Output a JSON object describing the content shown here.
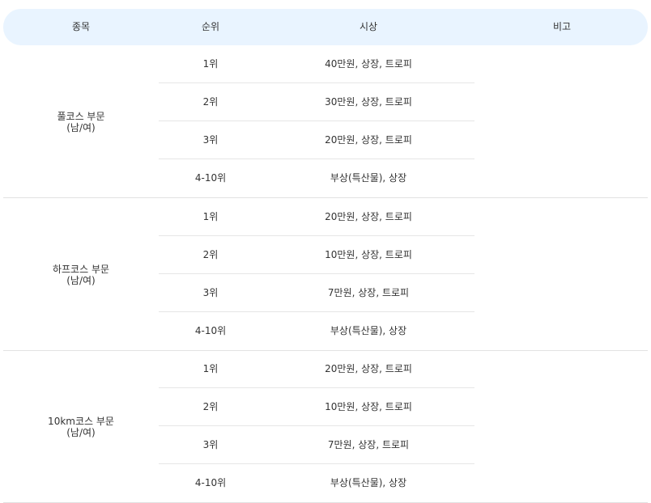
{
  "headers": {
    "event": "종목",
    "rank": "순위",
    "prize": "시상",
    "note": "비고"
  },
  "groups": [
    {
      "event_line1": "풀코스 부문",
      "event_line2": "(남/여)",
      "rows": [
        {
          "rank": "1위",
          "prize": "40만원, 상장, 트로피"
        },
        {
          "rank": "2위",
          "prize": "30만원, 상장, 트로피"
        },
        {
          "rank": "3위",
          "prize": "20만원, 상장, 트로피"
        },
        {
          "rank": "4-10위",
          "prize": "부상(특산물), 상장"
        }
      ]
    },
    {
      "event_line1": "하프코스 부문",
      "event_line2": "(남/여)",
      "rows": [
        {
          "rank": "1위",
          "prize": "20만원, 상장, 트로피"
        },
        {
          "rank": "2위",
          "prize": "10만원, 상장, 트로피"
        },
        {
          "rank": "3위",
          "prize": "7만원, 상장, 트로피"
        },
        {
          "rank": "4-10위",
          "prize": "부상(특산물), 상장"
        }
      ]
    },
    {
      "event_line1": "10km코스 부문",
      "event_line2": "(남/여)",
      "rows": [
        {
          "rank": "1위",
          "prize": "20만원, 상장, 트로피"
        },
        {
          "rank": "2위",
          "prize": "10만원, 상장, 트로피"
        },
        {
          "rank": "3위",
          "prize": "7만원, 상장, 트로피"
        },
        {
          "rank": "4-10위",
          "prize": "부상(특산물), 상장"
        }
      ]
    }
  ]
}
